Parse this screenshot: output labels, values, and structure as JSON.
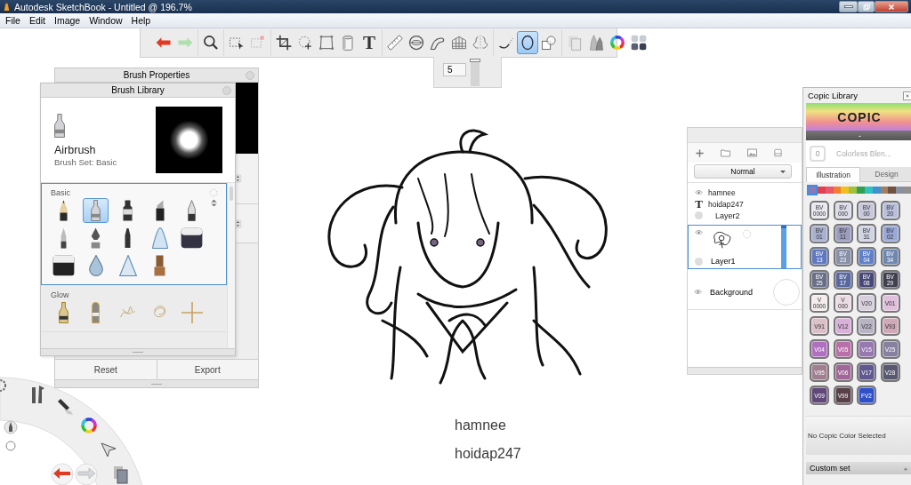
{
  "window": {
    "title": "Autodesk SketchBook - Untitled @ 196.7%"
  },
  "menu": [
    "File",
    "Edit",
    "Image",
    "Window",
    "Help"
  ],
  "toolbar": {
    "groups": [
      [
        {
          "kind": "undo",
          "selected": false
        },
        {
          "kind": "redo",
          "selected": false
        }
      ],
      [
        {
          "kind": "zoom",
          "selected": false
        }
      ],
      [
        {
          "kind": "select",
          "selected": false
        },
        {
          "kind": "select-add",
          "selected": false
        }
      ],
      [
        {
          "kind": "crop",
          "selected": false
        },
        {
          "kind": "lasso",
          "selected": false
        },
        {
          "kind": "distort",
          "selected": false
        },
        {
          "kind": "fill",
          "selected": false
        },
        {
          "kind": "text",
          "label": "T",
          "selected": false
        }
      ],
      [
        {
          "kind": "ruler",
          "selected": false
        },
        {
          "kind": "ellipse-guide",
          "selected": false
        },
        {
          "kind": "curve",
          "selected": false
        },
        {
          "kind": "perspective",
          "selected": false
        },
        {
          "kind": "symmetry",
          "selected": false
        }
      ],
      [
        {
          "kind": "stroke",
          "selected": false
        },
        {
          "kind": "ellipse",
          "selected": true
        },
        {
          "kind": "shape",
          "selected": false
        }
      ],
      [
        {
          "kind": "copy",
          "selected": false
        },
        {
          "kind": "brushes",
          "selected": false
        },
        {
          "kind": "colors",
          "selected": false
        },
        {
          "kind": "palette",
          "selected": false
        }
      ]
    ]
  },
  "brush_size": {
    "value": "5",
    "level": 1.0
  },
  "brush_properties": {
    "title": "Brush Properties",
    "buttons": [
      "Reset",
      "Export"
    ]
  },
  "brush_library": {
    "title": "Brush Library",
    "brush": {
      "name": "Airbrush",
      "set": "Brush Set: Basic"
    },
    "sets": [
      {
        "name": "Basic",
        "selected": true,
        "brushes": [
          {
            "kind": "pencil",
            "selected": false
          },
          {
            "kind": "airbrush",
            "selected": true
          },
          {
            "kind": "marker",
            "selected": false
          },
          {
            "kind": "chisel",
            "selected": false
          },
          {
            "kind": "ballpoint",
            "selected": false
          },
          {
            "kind": "paintbrush",
            "selected": false
          },
          {
            "kind": "inkpen",
            "selected": false
          },
          {
            "kind": "felt",
            "selected": false
          },
          {
            "kind": "smudge",
            "selected": false
          },
          {
            "kind": "block",
            "selected": false
          },
          {
            "kind": "eraser",
            "selected": false
          },
          {
            "kind": "drop",
            "selected": false
          },
          {
            "kind": "blur",
            "selected": false
          },
          {
            "kind": "stamp",
            "selected": false
          }
        ]
      },
      {
        "name": "Glow",
        "selected": false,
        "brushes": [
          {
            "kind": "glow-airbrush",
            "selected": false
          },
          {
            "kind": "glow-marker",
            "selected": false
          },
          {
            "kind": "scribble",
            "selected": false
          },
          {
            "kind": "rosette",
            "selected": false
          },
          {
            "kind": "cross",
            "selected": false
          }
        ]
      }
    ]
  },
  "layers": {
    "blend_mode": "Normal",
    "rows": [
      {
        "kind": "eye",
        "name": "hamnee",
        "selected": false
      },
      {
        "kind": "text",
        "icon_text": "T",
        "name": "hoidap247",
        "selected": false
      },
      {
        "kind": "dot",
        "name": "Layer2",
        "selected": false
      },
      {
        "kind": "paint",
        "name": "Layer1",
        "selected": true
      },
      {
        "kind": "background",
        "name": "Background",
        "selected": false
      }
    ]
  },
  "copic": {
    "title": "Copic Library",
    "logo": "COPIC",
    "blender": {
      "code": "0",
      "name": "Colorless Blen..."
    },
    "tabs": [
      {
        "label": "Illustration",
        "selected": true
      },
      {
        "label": "Design",
        "selected": false
      }
    ],
    "families": [
      {
        "color": "#8a78b8",
        "selected": true
      },
      {
        "color": "#e04050",
        "selected": false
      },
      {
        "color": "#e85868",
        "selected": false
      },
      {
        "color": "#f08030",
        "selected": false
      },
      {
        "color": "#f0c020",
        "selected": false
      },
      {
        "color": "#a0c040",
        "selected": false
      },
      {
        "color": "#30a050",
        "selected": false
      },
      {
        "color": "#30c0c0",
        "selected": false
      },
      {
        "color": "#4090d0",
        "selected": false
      },
      {
        "color": "#a08060",
        "selected": false
      },
      {
        "color": "#705040",
        "selected": false
      },
      {
        "color": "#8890a0",
        "selected": false
      },
      {
        "color": "#909090",
        "selected": false
      }
    ],
    "swatches": [
      {
        "lines": [
          "BV",
          "0000"
        ],
        "color": "#e8e8f0"
      },
      {
        "lines": [
          "BV",
          "000"
        ],
        "color": "#dcdce8"
      },
      {
        "lines": [
          "BV",
          "00"
        ],
        "color": "#c8c8dc"
      },
      {
        "lines": [
          "BV",
          "20"
        ],
        "color": "#b8c0dc"
      },
      {
        "lines": [
          "BV",
          "01"
        ],
        "color": "#a8b0d0"
      },
      {
        "lines": [
          "BV",
          "11"
        ],
        "color": "#9c9cc0"
      },
      {
        "lines": [
          "BV",
          "31"
        ],
        "color": "#d0d4e4"
      },
      {
        "lines": [
          "BV",
          "02"
        ],
        "color": "#98a8d8"
      },
      {
        "lines": [
          "BV",
          "13"
        ],
        "color": "#6078c0"
      },
      {
        "lines": [
          "BV",
          "23"
        ],
        "color": "#8890a8"
      },
      {
        "lines": [
          "BV",
          "04"
        ],
        "color": "#6080c8"
      },
      {
        "lines": [
          "BV",
          "34"
        ],
        "color": "#7088b0"
      },
      {
        "lines": [
          "BV",
          "25"
        ],
        "color": "#687088"
      },
      {
        "lines": [
          "BV",
          "17"
        ],
        "color": "#5868a0"
      },
      {
        "lines": [
          "BV",
          "08"
        ],
        "color": "#484878"
      },
      {
        "lines": [
          "BV",
          "29"
        ],
        "color": "#404050"
      },
      {
        "lines": [
          "V",
          "0000"
        ],
        "color": "#f4ecec"
      },
      {
        "lines": [
          "V",
          "000"
        ],
        "color": "#ecdce4"
      },
      {
        "lines": [
          "V20"
        ],
        "color": "#d8d0dc"
      },
      {
        "lines": [
          "V01"
        ],
        "color": "#e0c0dc"
      },
      {
        "lines": [
          "V91"
        ],
        "color": "#dcc0c8"
      },
      {
        "lines": [
          "V12"
        ],
        "color": "#d8b0d8"
      },
      {
        "lines": [
          "V22"
        ],
        "color": "#b8b4c4"
      },
      {
        "lines": [
          "V93"
        ],
        "color": "#d0a8b8"
      },
      {
        "lines": [
          "V04"
        ],
        "color": "#b070c0"
      },
      {
        "lines": [
          "V05"
        ],
        "color": "#b870a8"
      },
      {
        "lines": [
          "V15"
        ],
        "color": "#9878b0"
      },
      {
        "lines": [
          "V25"
        ],
        "color": "#8880a0"
      },
      {
        "lines": [
          "V95"
        ],
        "color": "#a08090"
      },
      {
        "lines": [
          "V06"
        ],
        "color": "#a06898"
      },
      {
        "lines": [
          "V17"
        ],
        "color": "#605890"
      },
      {
        "lines": [
          "V28"
        ],
        "color": "#585870"
      },
      {
        "lines": [
          "V09"
        ],
        "color": "#604878"
      },
      {
        "lines": [
          "V99"
        ],
        "color": "#584048"
      },
      {
        "lines": [
          "FV2"
        ],
        "color": "#3050c8"
      }
    ],
    "status": "No Copic Color Selected",
    "custom_set": "Custom set"
  },
  "canvas": {
    "texts": [
      "hamnee",
      "hoidap247"
    ]
  }
}
